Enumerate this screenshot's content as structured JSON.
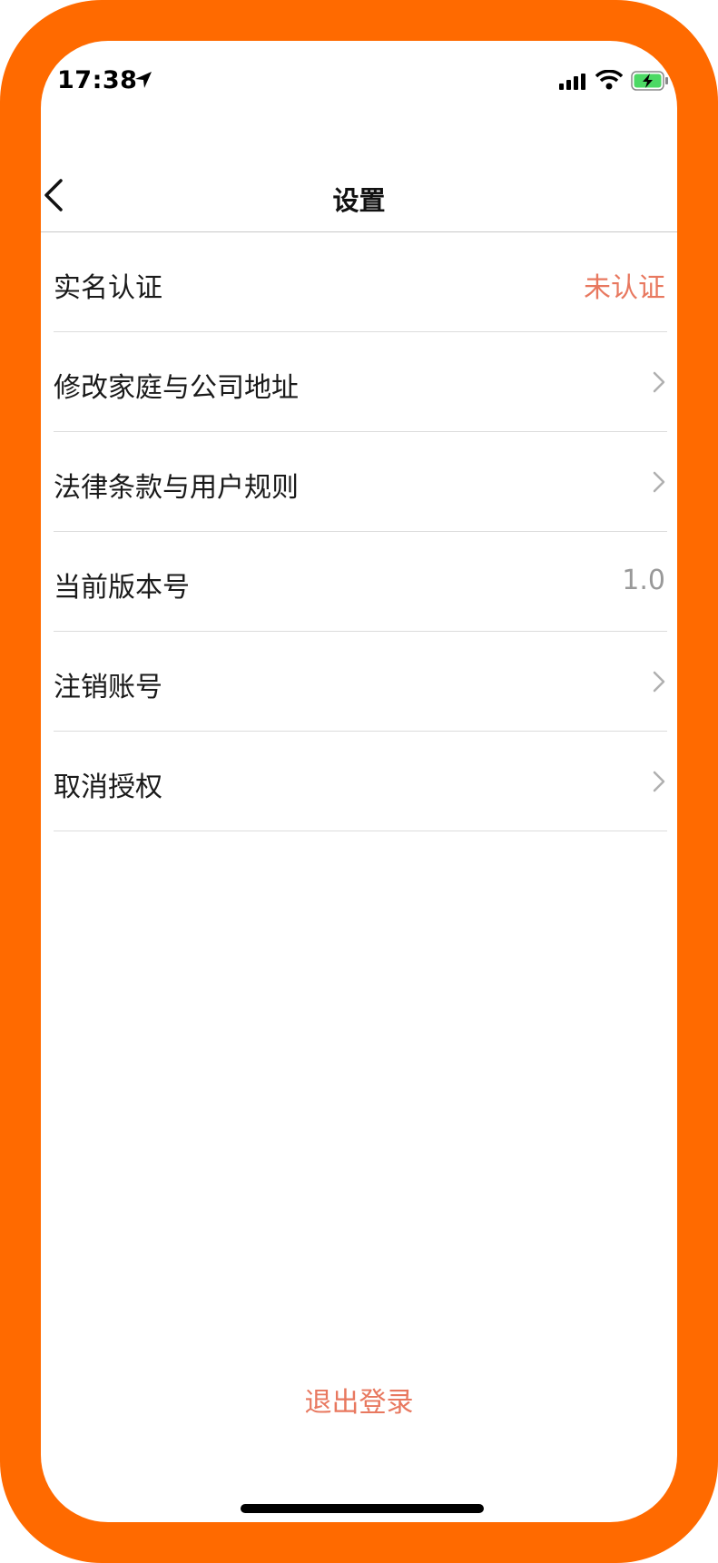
{
  "status_bar": {
    "time": "17:38"
  },
  "nav": {
    "title": "设置"
  },
  "settings": [
    {
      "label": "实名认证",
      "value": "未认证",
      "value_color": "#e8785f"
    },
    {
      "label": "修改家庭与公司地址",
      "chevron": true
    },
    {
      "label": "法律条款与用户规则",
      "chevron": true
    },
    {
      "label": "当前版本号",
      "value": "1.0"
    },
    {
      "label": "注销账号",
      "chevron": true
    },
    {
      "label": "取消授权",
      "chevron": true
    }
  ],
  "logout_label": "退出登录",
  "colors": {
    "frame": "#ff6a00",
    "accent": "#e8785f"
  },
  "icons": [
    "location-arrow-icon",
    "signal-icon",
    "wifi-icon",
    "battery-charging-icon",
    "back-chevron-icon",
    "chevron-right-icon"
  ]
}
